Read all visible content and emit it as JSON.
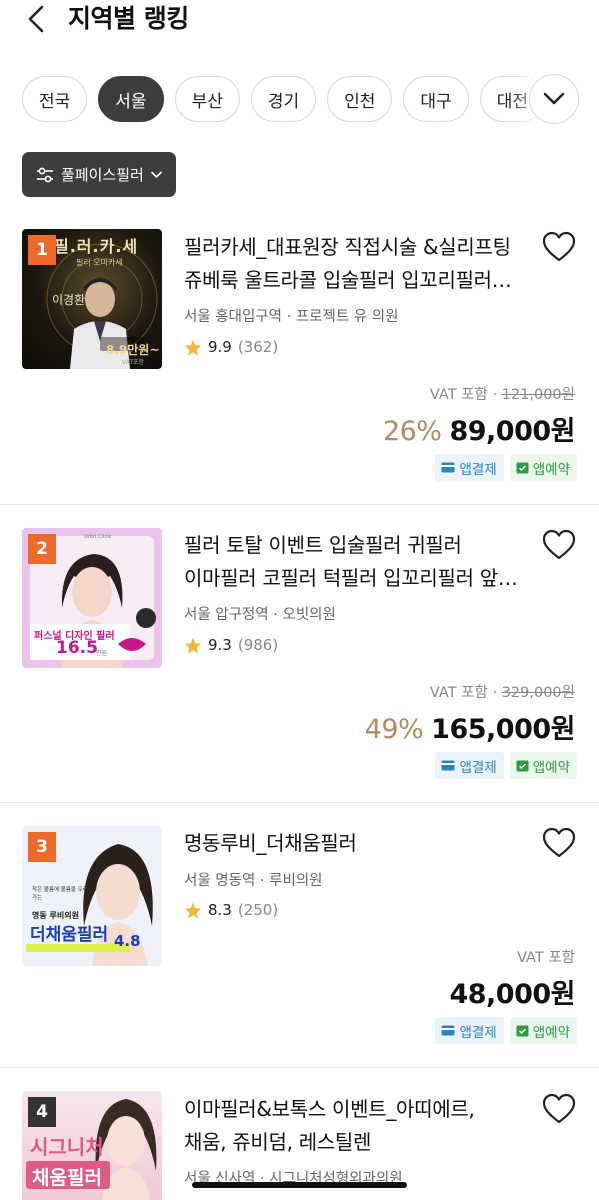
{
  "header": {
    "title": "지역별 랭킹"
  },
  "regions": [
    "전국",
    "서울",
    "부산",
    "경기",
    "인천",
    "대구",
    "대전"
  ],
  "active_region": "서울",
  "filter": {
    "label": "풀페이스필러"
  },
  "items": [
    {
      "rank": "1",
      "thumb_text": {
        "top": "필.러.카.세",
        "sub": "필러 오마카세",
        "name": "이경환",
        "price": "8.9만원~",
        "vat": "VAT포함"
      },
      "title_line1": "필러카세_대표원장 직접시술 &실리프팅",
      "title_line2": "쥬베룩 울트라콜 입술필러 입꼬리필러…",
      "location": "서울 홍대입구역 · 프로젝트 유 의원",
      "rating": "9.9",
      "reviews": "(362)",
      "vat_label": "VAT 포함 ·",
      "original_price": "121,000원",
      "discount": "26%",
      "price": "89,000원",
      "tag_pay": "앱결제",
      "tag_book": "앱예약"
    },
    {
      "rank": "2",
      "thumb_text": {
        "brand": "Orbit Clinic",
        "title": "퍼스널 디자인 필러",
        "price": "16.5",
        "unit": "만원"
      },
      "title_line1": "필러 토탈 이벤트 입술필러 귀필러",
      "title_line2": "이마필러 코필러 턱필러 입꼬리필러 앞…",
      "location": "서울 압구정역 · 오빗의원",
      "rating": "9.3",
      "reviews": "(986)",
      "vat_label": "VAT 포함 ·",
      "original_price": "329,000원",
      "discount": "49%",
      "price": "165,000원",
      "tag_pay": "앱결제",
      "tag_book": "앱예약"
    },
    {
      "rank": "3",
      "thumb_text": {
        "small": "작은 볼륨에 볼륨을 오래가는",
        "clinic": "명동 루비의원",
        "title": "더채움필러",
        "price": "4.8"
      },
      "title_line1": "명동루비_더채움필러",
      "location": "서울 명동역 · 루비의원",
      "rating": "8.3",
      "reviews": "(250)",
      "vat_label": "VAT 포함",
      "price": "48,000원",
      "tag_pay": "앱결제",
      "tag_book": "앱예약"
    },
    {
      "rank": "4",
      "thumb_text": {
        "top": "시그니처",
        "title": "채움필러"
      },
      "title_line1": "이마필러&보톡스 이벤트_아띠에르,",
      "title_line2": "채움, 쥬비덤, 레스틸렌",
      "location": "서울 신사역 · 시그니처성형외과의원"
    }
  ],
  "colors": {
    "rank_badge": "#ee6a2a",
    "discount": "#b08a63",
    "chip_active": "#3d3d3d",
    "pay_tag": "#2a86b8",
    "book_tag": "#2f9a45"
  }
}
